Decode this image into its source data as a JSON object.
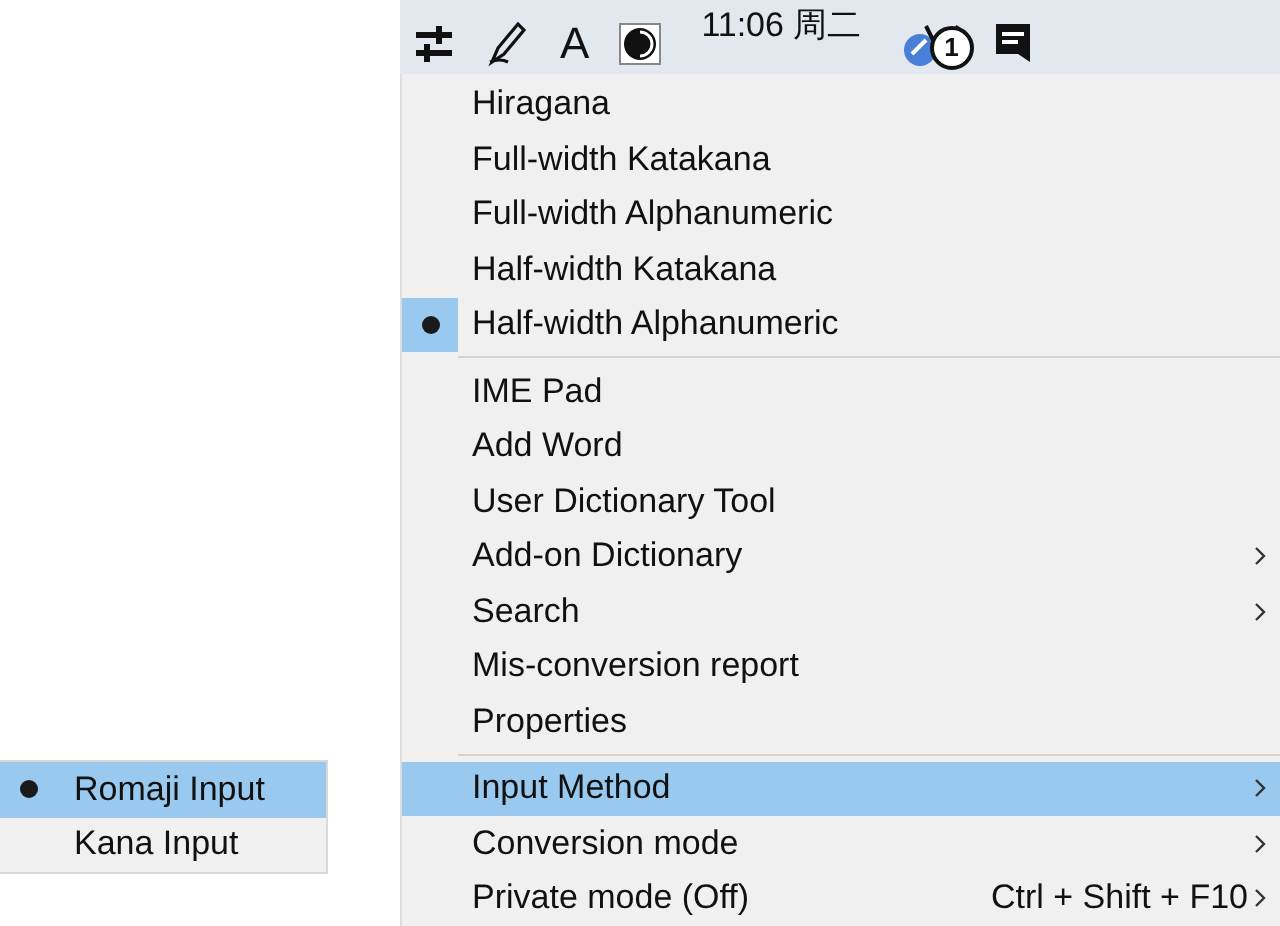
{
  "taskbar": {
    "font_indicator": "A",
    "clock_time": "11:06 周二",
    "badge": "1"
  },
  "menu": {
    "sections": [
      [
        {
          "label": "Hiragana",
          "kind": "command",
          "checked": false,
          "selected": false
        },
        {
          "label": "Full-width Katakana",
          "kind": "command",
          "checked": false,
          "selected": false
        },
        {
          "label": "Full-width Alphanumeric",
          "kind": "command",
          "checked": false,
          "selected": false
        },
        {
          "label": "Half-width Katakana",
          "kind": "command",
          "checked": false,
          "selected": false
        },
        {
          "label": "Half-width Alphanumeric",
          "kind": "command",
          "checked": true,
          "selected": false
        }
      ],
      [
        {
          "label": "IME Pad",
          "kind": "command",
          "selected": false
        },
        {
          "label": "Add Word",
          "kind": "command",
          "selected": false
        },
        {
          "label": "User Dictionary Tool",
          "kind": "command",
          "selected": false
        },
        {
          "label": "Add-on Dictionary",
          "kind": "submenu",
          "selected": false
        },
        {
          "label": "Search",
          "kind": "submenu",
          "selected": false
        },
        {
          "label": "Mis-conversion report",
          "kind": "command",
          "selected": false
        },
        {
          "label": "Properties",
          "kind": "command",
          "selected": false
        }
      ],
      [
        {
          "label": "Input Method",
          "kind": "submenu",
          "selected": true
        },
        {
          "label": "Conversion mode",
          "kind": "submenu",
          "selected": false
        },
        {
          "label": "Private mode (Off)",
          "kind": "submenu",
          "shortcut": "Ctrl + Shift + F10",
          "selected": false
        }
      ]
    ]
  },
  "submenu": {
    "items": [
      {
        "label": "Romaji Input",
        "checked": true,
        "selected": true
      },
      {
        "label": "Kana Input",
        "checked": false,
        "selected": false
      }
    ]
  }
}
